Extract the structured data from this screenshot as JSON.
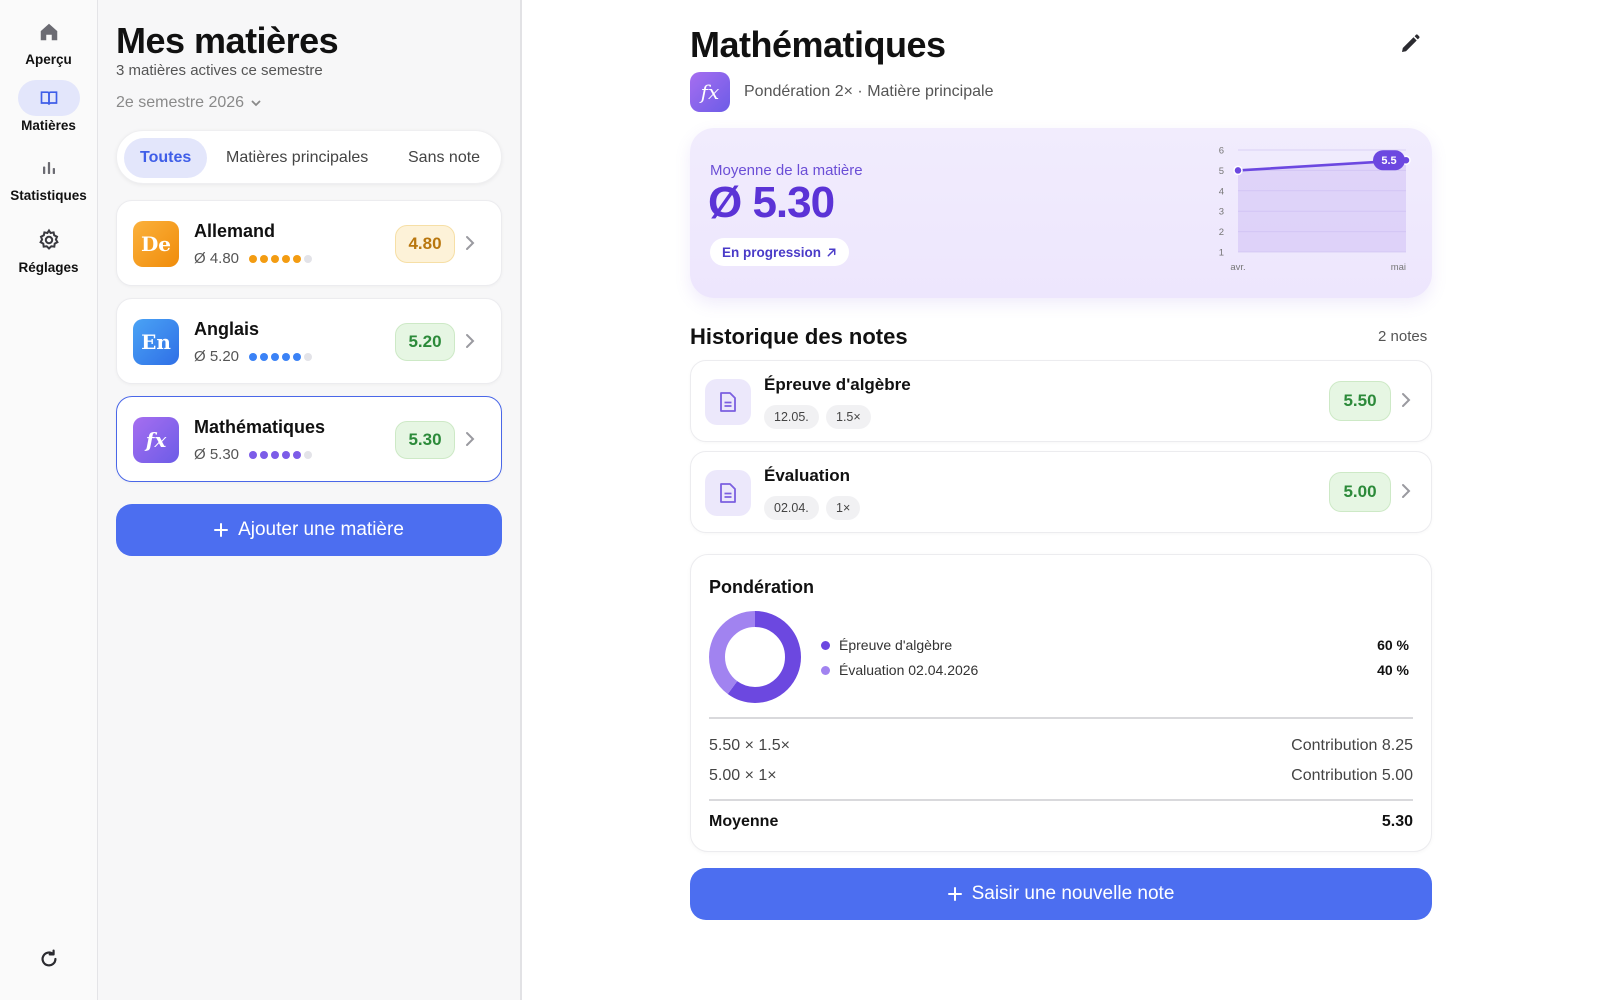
{
  "nav": {
    "items": [
      {
        "label": "Aperçu",
        "icon": "home-icon"
      },
      {
        "label": "Matières",
        "icon": "book-icon"
      },
      {
        "label": "Statistiques",
        "icon": "bar-chart-icon"
      },
      {
        "label": "Réglages",
        "icon": "gear-icon"
      }
    ],
    "active": "Matières",
    "refresh_icon": "refresh-icon"
  },
  "subjects_panel": {
    "title": "Mes matières",
    "subtitle": "3 matières actives ce semestre",
    "semester": "2e semestre 2026",
    "filters": [
      "Toutes",
      "Matières principales",
      "Sans note"
    ],
    "active_filter": "Toutes",
    "subjects": [
      {
        "abbr": "De",
        "name": "Allemand",
        "avg": "Ø 4.80",
        "score": "4.80",
        "dots_filled": 5,
        "dots_total": 6,
        "color": "#f39c12"
      },
      {
        "abbr": "En",
        "name": "Anglais",
        "avg": "Ø 5.20",
        "score": "5.20",
        "dots_filled": 5,
        "dots_total": 6,
        "color": "#3b82f6"
      },
      {
        "abbr": "fx",
        "name": "Mathématiques",
        "avg": "Ø 5.30",
        "score": "5.30",
        "dots_filled": 5,
        "dots_total": 6,
        "color": "#7c5ce8"
      }
    ],
    "selected": "Mathématiques",
    "add_button": "Ajouter une matière"
  },
  "detail": {
    "title": "Mathématiques",
    "logo": "fx",
    "meta": "Pondération 2× · Matière principale",
    "average": {
      "label": "Moyenne de la matière",
      "value": "Ø 5.30",
      "trend": "En progression",
      "trend_icon": "arrow-up-right-icon"
    },
    "history": {
      "title": "Historique des notes",
      "count": "2 notes",
      "notes": [
        {
          "name": "Épreuve d'algèbre",
          "date": "12.05.",
          "weight": "1.5×",
          "score": "5.50"
        },
        {
          "name": "Évaluation",
          "date": "02.04.",
          "weight": "1×",
          "score": "5.00"
        }
      ]
    },
    "weighting": {
      "title": "Pondération",
      "items": [
        {
          "label": "Épreuve d'algèbre",
          "pct": "60 %",
          "share": 0.6,
          "color": "#6c48e0"
        },
        {
          "label": "Évaluation 02.04.2026",
          "pct": "40 %",
          "share": 0.4,
          "color": "#a183f0"
        }
      ],
      "calc": [
        {
          "expr": "5.50 × 1.5×",
          "contribution": "Contribution 8.25"
        },
        {
          "expr": "5.00 × 1×",
          "contribution": "Contribution 5.00"
        }
      ],
      "total_label": "Moyenne",
      "total_value": "5.30"
    },
    "new_button": "Saisir une nouvelle note"
  },
  "chart_data": {
    "type": "line",
    "x": [
      "avr.",
      "mai"
    ],
    "series": [
      {
        "values": [
          5.0,
          5.5
        ]
      }
    ],
    "point_label": "5.5",
    "yticks": [
      "1",
      "2",
      "3",
      "4",
      "5",
      "6"
    ],
    "ylim": [
      1,
      6
    ]
  }
}
